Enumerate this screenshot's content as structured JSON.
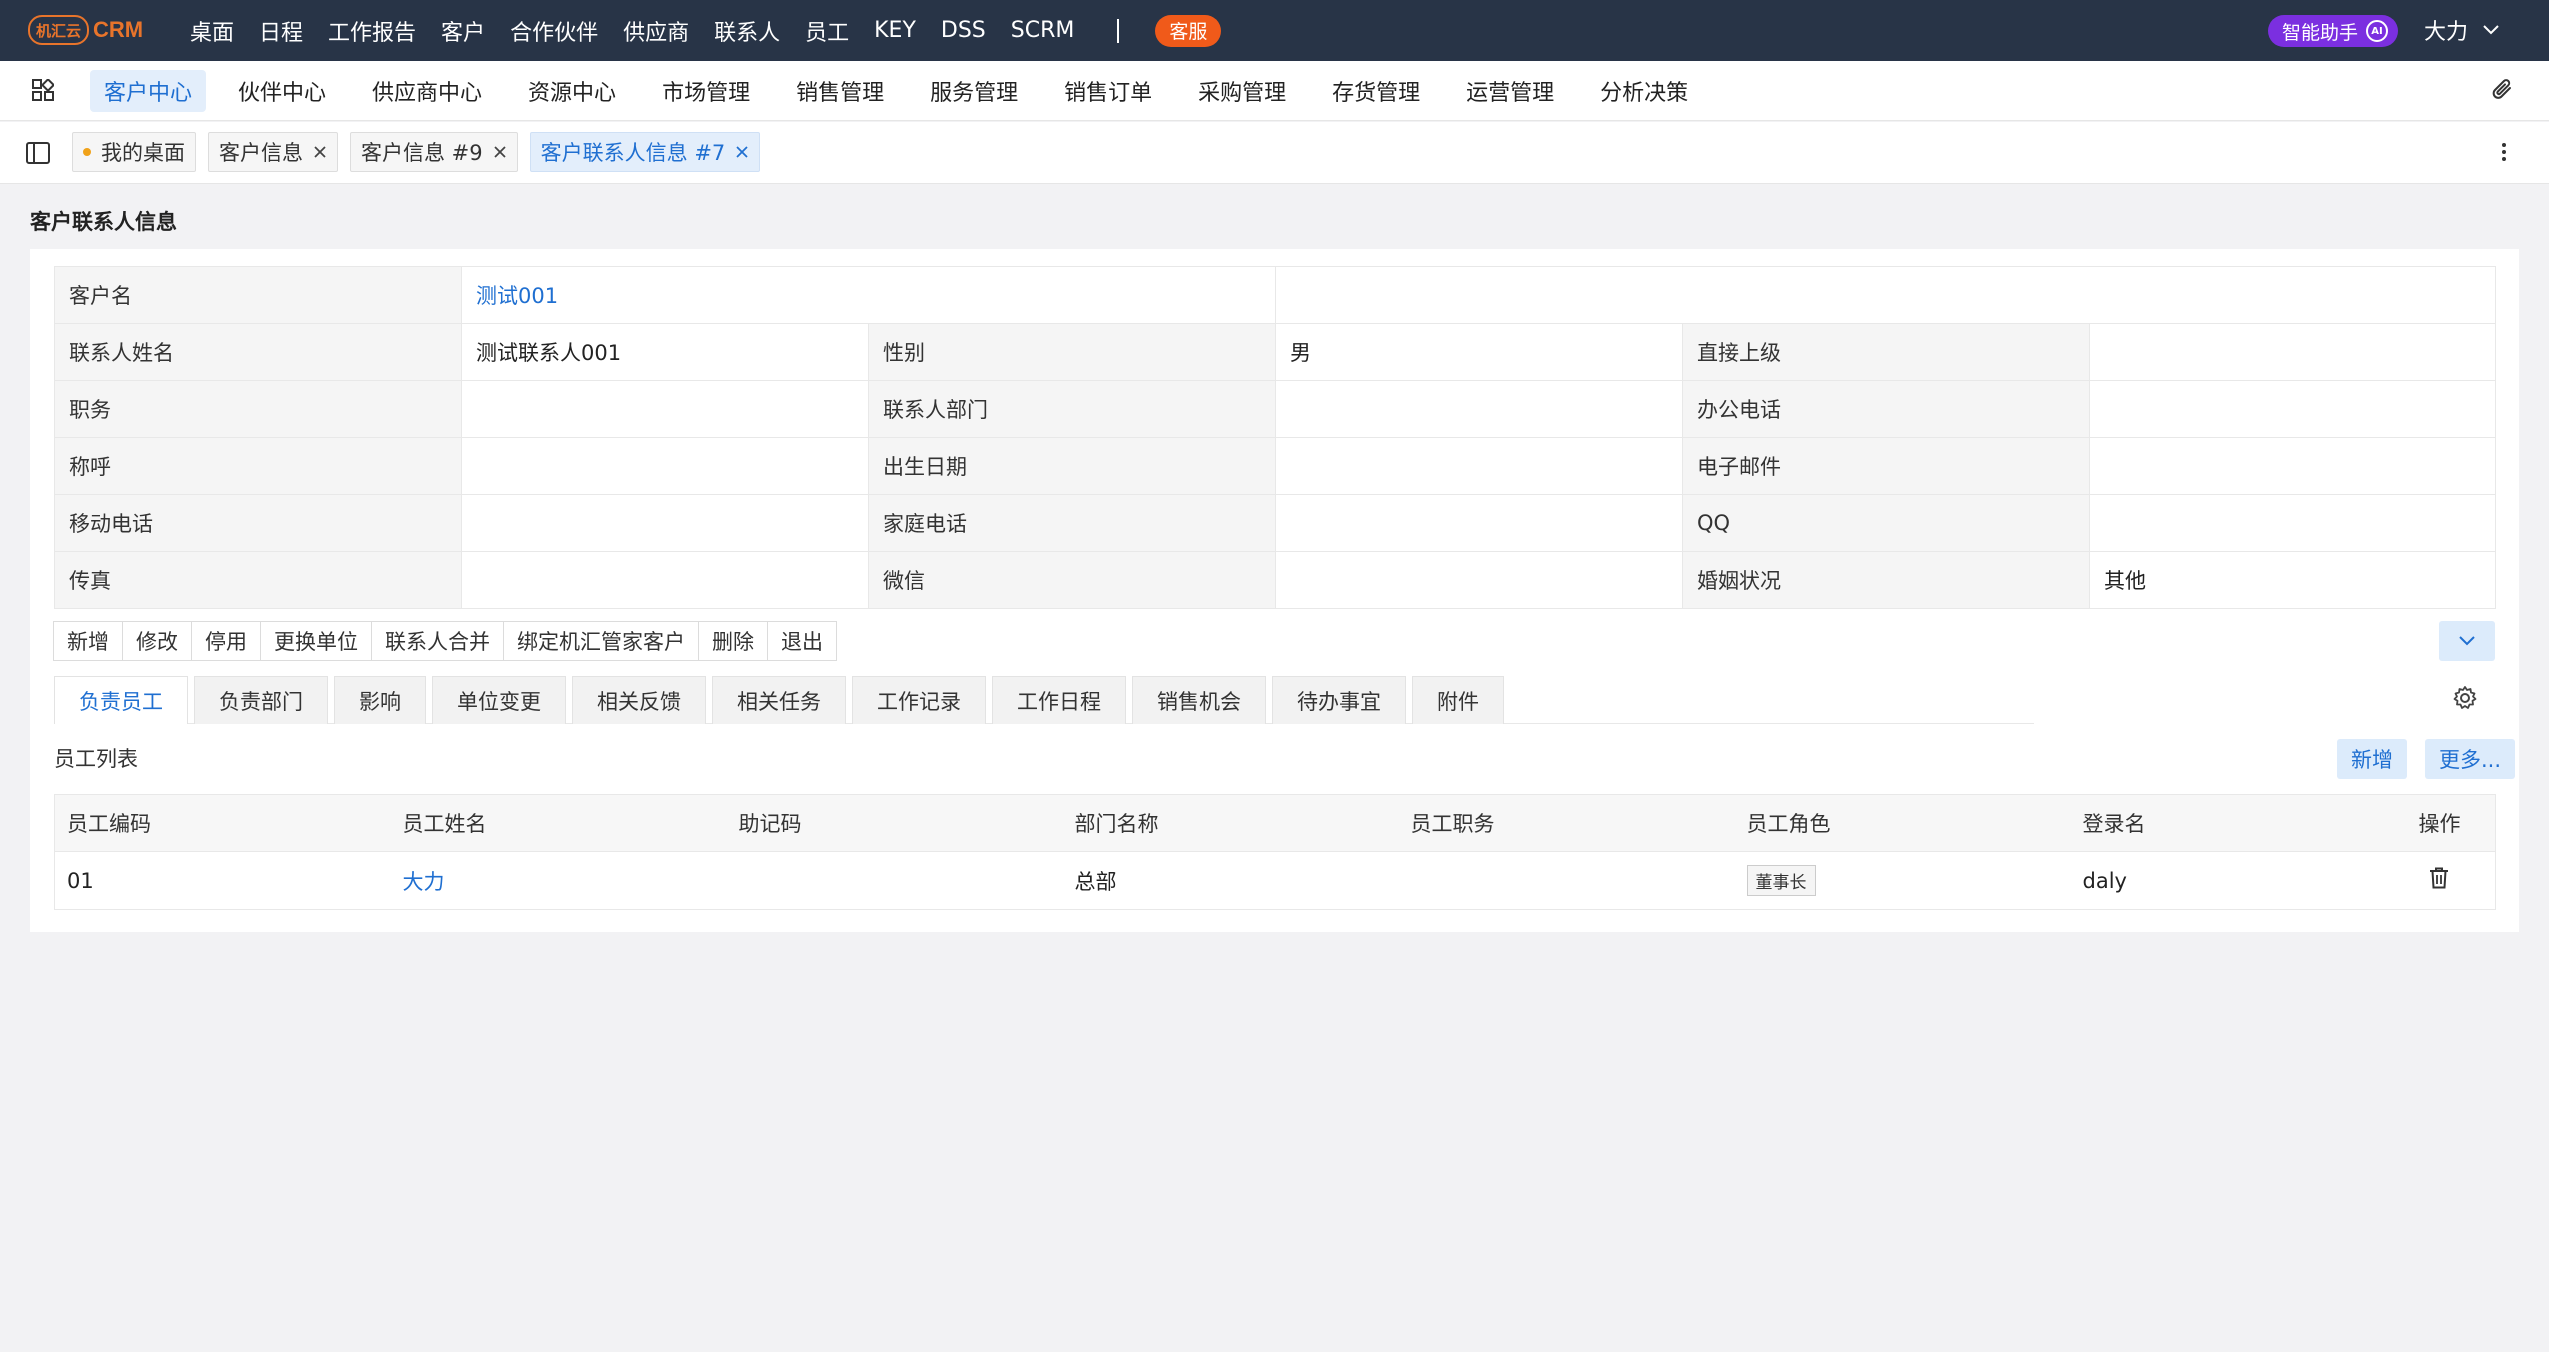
{
  "brand": {
    "badge": "机汇云",
    "name": "CRM",
    "accent": "#e8742b"
  },
  "topnav": {
    "items": [
      "桌面",
      "日程",
      "工作报告",
      "客户",
      "合作伙伴",
      "供应商",
      "联系人",
      "员工",
      "KEY",
      "DSS",
      "SCRM"
    ],
    "service_label": "客服",
    "ai_label": "智能助手",
    "ai_mark": "AI",
    "user_name": "大力"
  },
  "modules": {
    "items": [
      "客户中心",
      "伙伴中心",
      "供应商中心",
      "资源中心",
      "市场管理",
      "销售管理",
      "服务管理",
      "销售订单",
      "采购管理",
      "存货管理",
      "运营管理",
      "分析决策"
    ],
    "active_index": 0
  },
  "tabs": [
    {
      "label": "我的桌面",
      "dot": true,
      "closable": false,
      "active": false
    },
    {
      "label": "客户信息",
      "dot": false,
      "closable": true,
      "active": false
    },
    {
      "label": "客户信息 #9",
      "dot": false,
      "closable": true,
      "active": false
    },
    {
      "label": "客户联系人信息 #7",
      "dot": false,
      "closable": true,
      "active": true
    }
  ],
  "page": {
    "title": "客户联系人信息"
  },
  "info": {
    "customer_label": "客户名",
    "customer_value": "测试001",
    "rows": [
      [
        [
          "联系人姓名",
          "测试联系人001"
        ],
        [
          "性别",
          "男"
        ],
        [
          "直接上级",
          ""
        ]
      ],
      [
        [
          "职务",
          ""
        ],
        [
          "联系人部门",
          ""
        ],
        [
          "办公电话",
          ""
        ]
      ],
      [
        [
          "称呼",
          ""
        ],
        [
          "出生日期",
          ""
        ],
        [
          "电子邮件",
          ""
        ]
      ],
      [
        [
          "移动电话",
          ""
        ],
        [
          "家庭电话",
          ""
        ],
        [
          "QQ",
          ""
        ]
      ],
      [
        [
          "传真",
          ""
        ],
        [
          "微信",
          ""
        ],
        [
          "婚姻状况",
          "其他"
        ]
      ]
    ]
  },
  "actions": [
    "新增",
    "修改",
    "停用",
    "更换单位",
    "联系人合并",
    "绑定机汇管家客户",
    "删除",
    "退出"
  ],
  "subtabs": {
    "items": [
      "负责员工",
      "负责部门",
      "影响",
      "单位变更",
      "相关反馈",
      "相关任务",
      "工作记录",
      "工作日程",
      "销售机会",
      "待办事宜",
      "附件"
    ],
    "active_index": 0
  },
  "employee_list": {
    "title": "员工列表",
    "add_label": "新增",
    "more_label": "更多...",
    "columns": [
      "员工编码",
      "员工姓名",
      "助记码",
      "部门名称",
      "员工职务",
      "员工角色",
      "登录名",
      "操作"
    ],
    "rows": [
      {
        "code": "01",
        "name": "大力",
        "mnemonic": "",
        "dept": "总部",
        "title": "",
        "role": "董事长",
        "login": "daly"
      }
    ]
  }
}
